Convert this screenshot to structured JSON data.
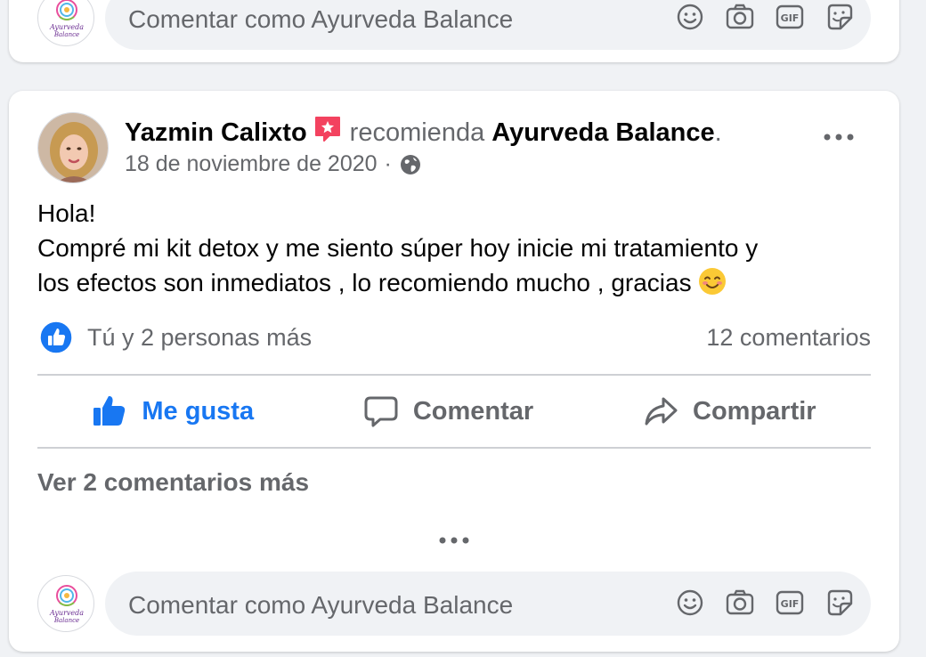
{
  "top_comment_composer": {
    "placeholder": "Comentar como Ayurveda Balance",
    "avatar_logo_text": "Ayurveda Balance",
    "icons": [
      "smiley-icon",
      "camera-icon",
      "gif-icon",
      "sticker-icon"
    ]
  },
  "post": {
    "author_name": "Yazmin Calixto",
    "recommends_text": "recomienda",
    "page_name": "Ayurveda Balance",
    "period": ".",
    "date": "18 de noviembre de 2020",
    "date_separator": "·",
    "privacy_icon": "globe-icon",
    "body_lines": [
      "Hola!",
      "Compré mi kit detox y me siento súper hoy inicie mi tratamiento y",
      "los efectos son inmediatos , lo recomiendo mucho , gracias"
    ],
    "body_emoji": "smiling-face-emoji",
    "reactions_text": "Tú y 2 personas más",
    "comments_count": "12 comentarios",
    "actions": {
      "like": "Me gusta",
      "comment": "Comentar",
      "share": "Compartir"
    },
    "view_more_comments": "Ver 2 comentarios más"
  },
  "bottom_comment_composer": {
    "placeholder": "Comentar como Ayurveda Balance",
    "avatar_logo_text": "Ayurveda Balance",
    "icons": [
      "smiley-icon",
      "camera-icon",
      "gif-icon",
      "sticker-icon"
    ]
  },
  "colors": {
    "background": "#f0f2f5",
    "card": "#ffffff",
    "primary_text": "#050505",
    "secondary_text": "#65676b",
    "facebook_blue": "#1877f2",
    "recommend_badge": "#f3425f",
    "divider": "#ced0d4"
  }
}
